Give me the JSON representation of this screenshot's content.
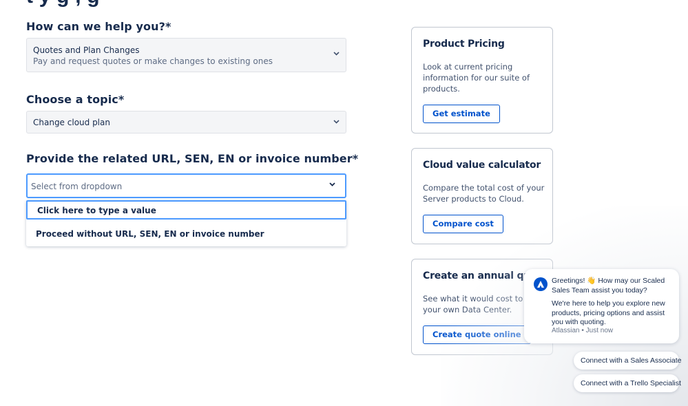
{
  "page": {
    "heading_partial": "t    y     g          ,                                     g"
  },
  "form": {
    "help": {
      "label": "How can we help you?*",
      "selected": "Quotes and Plan Changes",
      "selected_description": "Pay and request quotes or make changes to existing ones",
      "chevron_icon": "chevron-down-icon"
    },
    "topic": {
      "label": "Choose a topic*",
      "selected": "Change cloud plan",
      "chevron_icon": "chevron-down-icon"
    },
    "reference": {
      "label": "Provide the related URL, SEN, EN or invoice number*",
      "placeholder": "Select from dropdown",
      "chevron_icon": "chevron-down-icon",
      "options": [
        "Click here to type a value",
        "Proceed without URL, SEN, EN or invoice number"
      ],
      "focused_option_index": 0
    }
  },
  "cards": [
    {
      "title": "Product Pricing",
      "description": "Look at current pricing information for our suite of products.",
      "button": "Get estimate"
    },
    {
      "title": "Cloud value calculator",
      "description": "Compare the total cost of your Server products to Cloud.",
      "button": "Compare cost"
    },
    {
      "title": "Create an annual quote",
      "description": "See what it would cost to host your own Data Center.",
      "button": "Create quote online"
    }
  ],
  "chat": {
    "avatar_icon": "atlassian-logo-icon",
    "greeting": "Greetings! 👋 How may our Scaled Sales Team assist you today?",
    "message": "We're here to help you explore new products, pricing options and assist you with quoting.",
    "meta": "Atlassian • Just now",
    "quick_replies": [
      "Connect with a Sales Associate",
      "Connect with a Trello Specialist"
    ]
  },
  "colors": {
    "text": "#172b4d",
    "accent": "#0052cc",
    "focus": "#4c9aff",
    "field_bg": "#f4f5f7"
  }
}
